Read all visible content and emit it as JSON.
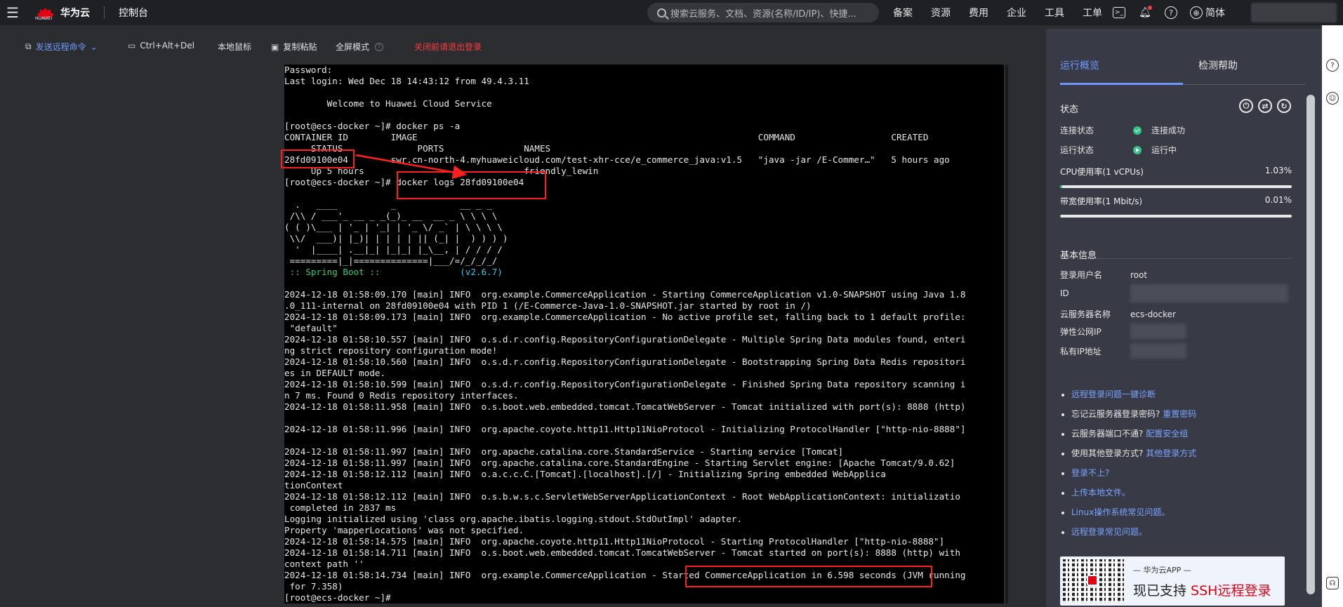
{
  "topbar": {
    "menu_icon": "hamburger-icon",
    "brand_sub": "HUAWEI",
    "brand": "华为云",
    "console": "控制台",
    "search_placeholder": "搜索云服务、文档、资源(名称/ID/IP)、快捷...",
    "links": [
      "备案",
      "资源",
      "费用",
      "企业",
      "工具",
      "工单"
    ],
    "language": "简体"
  },
  "toolbar": {
    "send_command": "发送远程命令",
    "ctrl_alt_del": "Ctrl+Alt+Del",
    "local_mouse": "本地鼠标",
    "copy_paste": "复制粘贴",
    "fullscreen": "全屏模式",
    "close_warning": "关闭前请退出登录"
  },
  "terminal": {
    "lines": [
      "Password:",
      "Last login: Wed Dec 18 14:43:12 from 49.4.3.11",
      "",
      "        Welcome to Huawei Cloud Service",
      "",
      "[root@ecs-docker ~]# docker ps -a",
      "CONTAINER ID        IMAGE                                                                COMMAND                  CREATED",
      "     STATUS              PORTS               NAMES",
      "28fd09100e04        swr.cn-north-4.myhuaweicloud.com/test-xhr-cce/e_commerce_java:v1.5   \"java -jar /E-Commer…\"   5 hours ago",
      "     Up 5 hours                              friendly_lewin",
      "[root@ecs-docker ~]# docker logs 28fd09100e04",
      "",
      "  .   ____          _            __ _ _",
      " /\\\\ / ___'_ __ _ _(_)_ __  __ _ \\ \\ \\ \\",
      "( ( )\\___ | '_ | '_| | '_ \\/ _` | \\ \\ \\ \\",
      " \\\\/  ___)| |_)| | | | | || (_| |  ) ) ) )",
      "  '  |____| .__|_| |_|_| |_\\__, | / / / /",
      " =========|_|==============|___/=/_/_/_/",
      "SPRING_BOOT_LINE",
      "",
      "2024-12-18 01:58:09.170 [main] INFO  org.example.CommerceApplication - Starting CommerceApplication v1.0-SNAPSHOT using Java 1.8",
      ".0_111-internal on 28fd09100e04 with PID 1 (/E-Commerce-Java-1.0-SNAPSHOT.jar started by root in /)",
      "2024-12-18 01:58:09.173 [main] INFO  org.example.CommerceApplication - No active profile set, falling back to 1 default profile:",
      " \"default\"",
      "2024-12-18 01:58:10.557 [main] INFO  o.s.d.r.config.RepositoryConfigurationDelegate - Multiple Spring Data modules found, enteri",
      "ng strict repository configuration mode!",
      "2024-12-18 01:58:10.560 [main] INFO  o.s.d.r.config.RepositoryConfigurationDelegate - Bootstrapping Spring Data Redis repositori",
      "es in DEFAULT mode.",
      "2024-12-18 01:58:10.599 [main] INFO  o.s.d.r.config.RepositoryConfigurationDelegate - Finished Spring Data repository scanning i",
      "n 7 ms. Found 0 Redis repository interfaces.",
      "2024-12-18 01:58:11.958 [main] INFO  o.s.boot.web.embedded.tomcat.TomcatWebServer - Tomcat initialized with port(s): 8888 (http)",
      "",
      "2024-12-18 01:58:11.996 [main] INFO  org.apache.coyote.http11.Http11NioProtocol - Initializing ProtocolHandler [\"http-nio-8888\"]",
      "",
      "2024-12-18 01:58:11.997 [main] INFO  org.apache.catalina.core.StandardService - Starting service [Tomcat]",
      "2024-12-18 01:58:11.997 [main] INFO  org.apache.catalina.core.StandardEngine - Starting Servlet engine: [Apache Tomcat/9.0.62]",
      "2024-12-18 01:58:12.112 [main] INFO  o.a.c.c.C.[Tomcat].[localhost].[/] - Initializing Spring embedded WebApplica",
      "tionContext",
      "2024-12-18 01:58:12.112 [main] INFO  o.s.b.w.s.c.ServletWebServerApplicationContext - Root WebApplicationContext: initializatio",
      " completed in 2837 ms",
      "Logging initialized using 'class org.apache.ibatis.logging.stdout.StdOutImpl' adapter.",
      "Property 'mapperLocations' was not specified.",
      "2024-12-18 01:58:14.575 [main] INFO  org.apache.coyote.http11.Http11NioProtocol - Starting ProtocolHandler [\"http-nio-8888\"]",
      "2024-12-18 01:58:14.711 [main] INFO  o.s.boot.web.embedded.tomcat.TomcatWebServer - Tomcat started on port(s): 8888 (http) with",
      "context path ''",
      "2024-12-18 01:58:14.734 [main] INFO  org.example.CommerceApplication - Started CommerceApplication in 6.598 seconds (JVM running",
      " for 7.358)",
      "[root@ecs-docker ~]#"
    ],
    "spring_boot_label": " :: Spring Boot ::",
    "spring_boot_version": "(v2.6.7)"
  },
  "panel": {
    "tabs": [
      "运行概览",
      "检测帮助"
    ],
    "status_title": "状态",
    "status_icons": [
      "power-icon",
      "sync-icon",
      "refresh-icon"
    ],
    "connect_label": "连接状态",
    "connect_value": "连接成功",
    "run_label": "运行状态",
    "run_value": "运行中",
    "cpu_label": "CPU使用率(1 vCPUs)",
    "cpu_value": "1.03%",
    "cpu_fraction": 0.0103,
    "bw_label": "带宽使用率(1 Mbit/s)",
    "bw_value": "0.01%",
    "bw_fraction": 0.0001,
    "basic_title": "基本信息",
    "login_user_label": "登录用户名",
    "login_user_value": "root",
    "id_label": "ID",
    "server_name_label": "云服务器名称",
    "server_name_value": "ecs-docker",
    "eip_label": "弹性公网IP",
    "private_ip_label": "私有IP地址",
    "help_items": [
      {
        "text": "",
        "link": "远程登录问题一键诊断"
      },
      {
        "text": "忘记云服务器登录密码?",
        "link": "重置密码"
      },
      {
        "text": "云服务器端口不通?",
        "link": "配置安全组"
      },
      {
        "text": "使用其他登录方式?",
        "link": "其他登录方式"
      },
      {
        "text": "",
        "link": "登录不上?"
      },
      {
        "text": "",
        "link": "上传本地文件。"
      },
      {
        "text": "",
        "link": "Linux操作系统常见问题。"
      },
      {
        "text": "",
        "link": "远程登录常见问题。"
      }
    ],
    "promo_sub": "— 华为云APP —",
    "promo_main_a": "现已支持 ",
    "promo_main_b": "SSH远程登录"
  },
  "colors": {
    "accent_blue": "#6f98ff",
    "success_green": "#36c48a",
    "annotation_red": "#ff1f1f",
    "brand_red": "#e60012"
  }
}
